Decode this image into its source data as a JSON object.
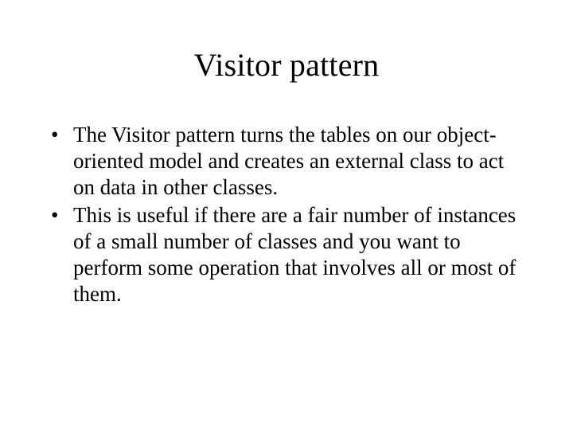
{
  "slide": {
    "title": "Visitor pattern",
    "bullets": [
      "The Visitor pattern turns the tables on our object-oriented model and creates an external class to act on data in other classes.",
      "This is useful if there are a fair number of instances of a small number of classes and you want to perform some operation that involves all or most of them."
    ]
  }
}
